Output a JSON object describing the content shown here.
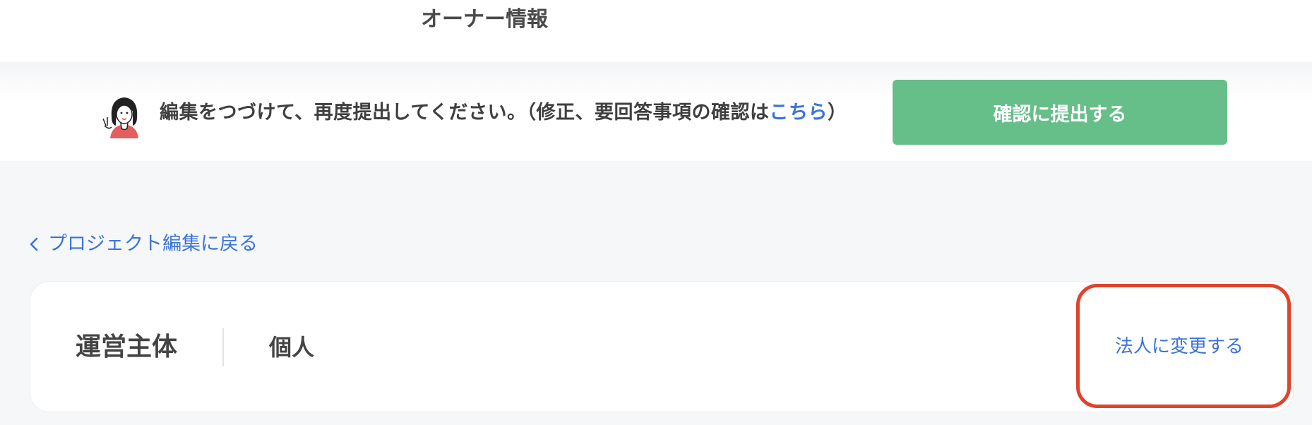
{
  "header": {
    "title": "オーナー情報"
  },
  "notice": {
    "message": "編集をつづけて、再度提出してください。（修正、要回答事項の確認は",
    "link_label": "こちら",
    "closing": "）",
    "avatar_icon": "woman-avatar-icon"
  },
  "submit_button": {
    "label": "確認に提出する"
  },
  "back_link": {
    "label": "プロジェクト編集に戻る",
    "icon": "chevron-left-icon"
  },
  "entity_card": {
    "label": "運営主体",
    "value": "個人",
    "change_link": "法人に変更する"
  },
  "colors": {
    "accent_blue": "#3b73d9",
    "submit_green": "#66be89",
    "highlight_red": "#e0432b"
  }
}
